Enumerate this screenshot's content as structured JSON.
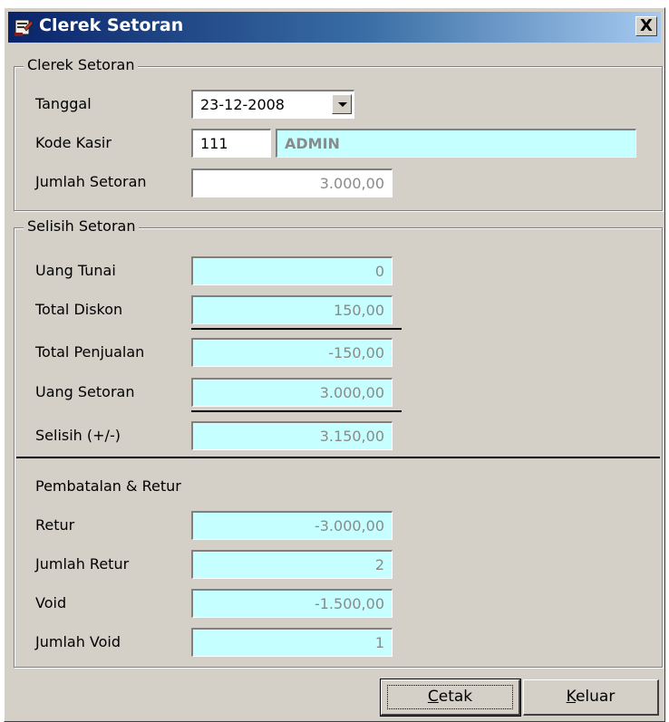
{
  "window": {
    "title": "Clerek Setoran",
    "close_label": "X"
  },
  "group_setoran": {
    "legend": "Clerek Setoran",
    "tanggal_label": "Tanggal",
    "tanggal_value": "23-12-2008",
    "kode_kasir_label": "Kode Kasir",
    "kode_kasir_value": "111",
    "kasir_name": "ADMIN",
    "jumlah_setoran_label": "Jumlah Setoran",
    "jumlah_setoran_value": "3.000,00"
  },
  "group_selisih": {
    "legend": "Selisih Setoran",
    "rows": [
      {
        "label": "Uang Tunai",
        "value": "0"
      },
      {
        "label": "Total Diskon",
        "value": "150,00"
      },
      {
        "label": "Total Penjualan",
        "value": "-150,00"
      },
      {
        "label": "Uang Setoran",
        "value": "3.000,00"
      },
      {
        "label": "Selisih (+/-)",
        "value": "3.150,00"
      }
    ],
    "section_title": "Pembatalan & Retur",
    "retur_rows": [
      {
        "label": "Retur",
        "value": "-3.000,00"
      },
      {
        "label": "Jumlah Retur",
        "value": "2"
      },
      {
        "label": "Void",
        "value": "-1.500,00"
      },
      {
        "label": "Jumlah Void",
        "value": "1"
      }
    ]
  },
  "buttons": {
    "cetak_first": "C",
    "cetak_rest": "etak",
    "keluar_first": "K",
    "keluar_rest": "eluar"
  }
}
